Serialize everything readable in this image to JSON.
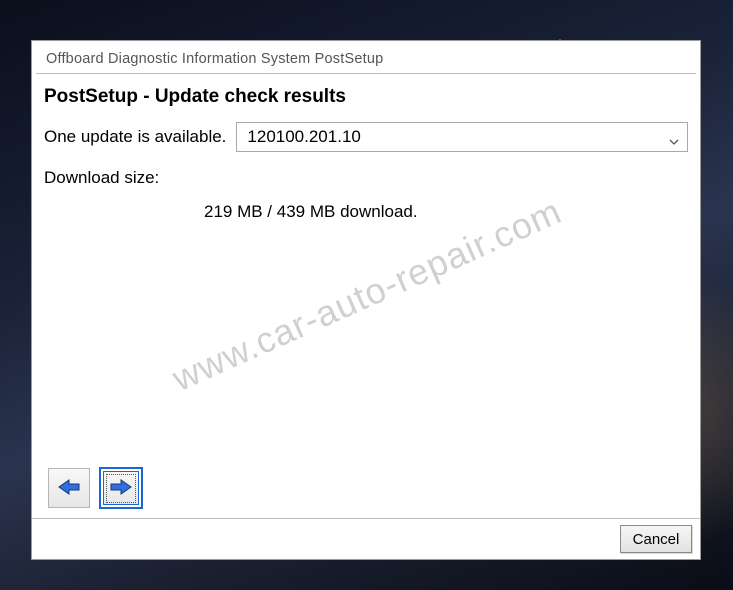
{
  "window": {
    "title": "Offboard Diagnostic Information System PostSetup"
  },
  "content": {
    "heading": "PostSetup - Update check results",
    "available_label": "One update is available.",
    "version_selected": "120100.201.10",
    "download_size_label": "Download size:",
    "download_size_value": "219 MB / 439 MB download."
  },
  "buttons": {
    "cancel": "Cancel"
  },
  "icons": {
    "back": "arrow-left",
    "forward": "arrow-right",
    "chevron": "chevron-down"
  },
  "watermark": "www.car-auto-repair.com",
  "colors": {
    "arrow_fill": "#2f6fe0",
    "arrow_stroke": "#14397a"
  }
}
